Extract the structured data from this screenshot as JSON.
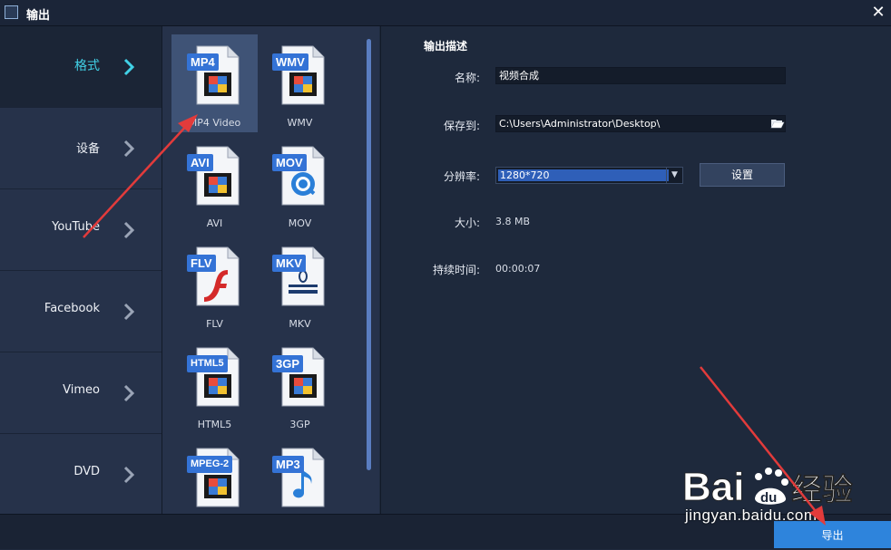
{
  "window": {
    "title": "输出",
    "close_symbol": "✕"
  },
  "sidebar": {
    "items": [
      {
        "label": "格式",
        "active": true
      },
      {
        "label": "设备",
        "active": false
      },
      {
        "label": "YouTube",
        "active": false
      },
      {
        "label": "Facebook",
        "active": false
      },
      {
        "label": "Vimeo",
        "active": false
      },
      {
        "label": "DVD",
        "active": false
      }
    ]
  },
  "formats": [
    {
      "badge": "MP4",
      "label": "MP4 Video",
      "icon": "film-strip-icon",
      "selected": true
    },
    {
      "badge": "WMV",
      "label": "WMV",
      "icon": "film-strip-icon",
      "selected": false
    },
    {
      "badge": "AVI",
      "label": "AVI",
      "icon": "film-strip-icon",
      "selected": false
    },
    {
      "badge": "MOV",
      "label": "MOV",
      "icon": "quicktime-icon",
      "selected": false
    },
    {
      "badge": "FLV",
      "label": "FLV",
      "icon": "flash-icon",
      "selected": false
    },
    {
      "badge": "MKV",
      "label": "MKV",
      "icon": "matroska-icon",
      "selected": false
    },
    {
      "badge": "HTML5",
      "label": "HTML5",
      "icon": "film-strip-icon",
      "selected": false
    },
    {
      "badge": "3GP",
      "label": "3GP",
      "icon": "film-strip-icon",
      "selected": false
    },
    {
      "badge": "MPEG-2",
      "label": "",
      "icon": "film-strip-icon",
      "selected": false
    },
    {
      "badge": "MP3",
      "label": "",
      "icon": "music-note-icon",
      "selected": false
    }
  ],
  "output": {
    "section_title": "输出描述",
    "name_label": "名称:",
    "name_value": "视频合成",
    "save_label": "保存到:",
    "save_path": "C:\\Users\\Administrator\\Desktop\\",
    "resolution_label": "分辨率:",
    "resolution_value": "1280*720",
    "settings_button": "设置",
    "size_label": "大小:",
    "size_value": "3.8 MB",
    "duration_label": "持续时间:",
    "duration_value": "00:00:07"
  },
  "footer": {
    "export_button": "导出"
  },
  "watermark": {
    "brand": "Baidu经验",
    "url": "jingyan.baidu.com"
  },
  "colors": {
    "accent": "#41d1e6",
    "badge": "#3473d6",
    "export": "#2e84dc",
    "annotation_arrow": "#e23b3b"
  }
}
